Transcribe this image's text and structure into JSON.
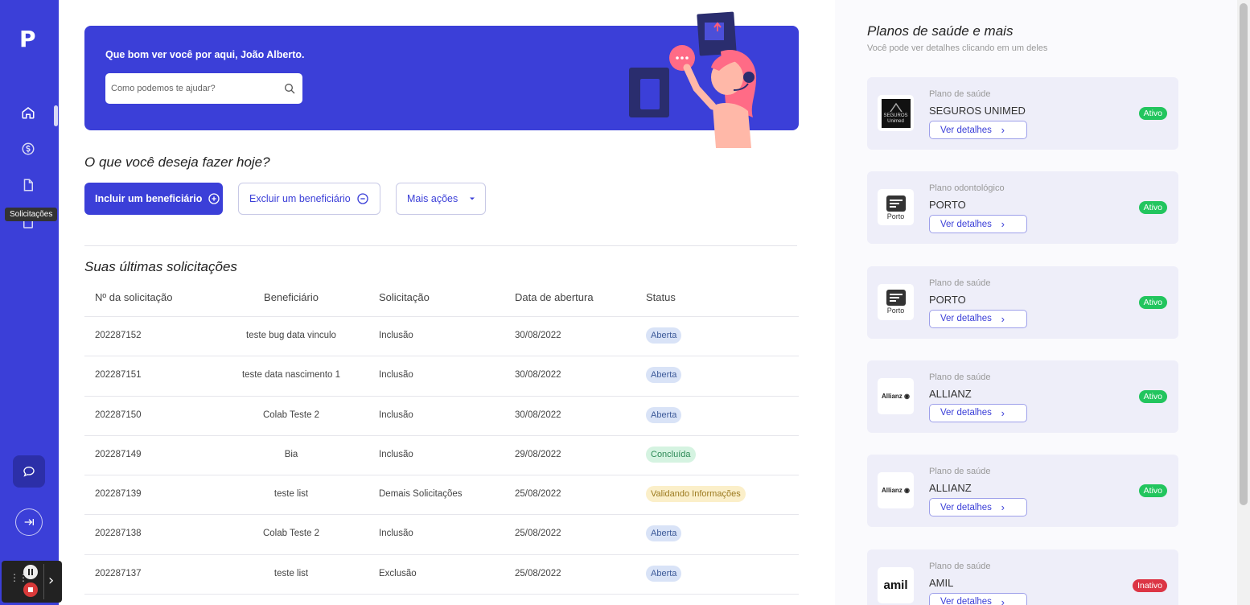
{
  "sidebar": {
    "logo": "P",
    "tooltip": "Solicitações"
  },
  "banner": {
    "greeting": "Que bom ver você por aqui, João Alberto.",
    "search_placeholder": "Como podemos te ajudar?"
  },
  "actions": {
    "title": "O que você deseja fazer hoje?",
    "include": "Incluir um beneficiário",
    "exclude": "Excluir um beneficiário",
    "more": "Mais ações"
  },
  "requests": {
    "title": "Suas últimas solicitações",
    "headers": [
      "Nº da solicitação",
      "Beneficiário",
      "Solicitação",
      "Data de abertura",
      "Status"
    ],
    "rows": [
      {
        "id": "202287152",
        "beneficiary": "teste bug data vinculo",
        "type": "Inclusão",
        "date": "30/08/2022",
        "status": "Aberta"
      },
      {
        "id": "202287151",
        "beneficiary": "teste data nascimento 1",
        "type": "Inclusão",
        "date": "30/08/2022",
        "status": "Aberta"
      },
      {
        "id": "202287150",
        "beneficiary": "Colab Teste 2",
        "type": "Inclusão",
        "date": "30/08/2022",
        "status": "Aberta"
      },
      {
        "id": "202287149",
        "beneficiary": "Bia",
        "type": "Inclusão",
        "date": "29/08/2022",
        "status": "Concluída"
      },
      {
        "id": "202287139",
        "beneficiary": "teste list",
        "type": "Demais Solicitações",
        "date": "25/08/2022",
        "status": "Validando Informações"
      },
      {
        "id": "202287138",
        "beneficiary": "Colab Teste 2",
        "type": "Inclusão",
        "date": "25/08/2022",
        "status": "Aberta"
      },
      {
        "id": "202287137",
        "beneficiary": "teste list",
        "type": "Exclusão",
        "date": "25/08/2022",
        "status": "Aberta"
      }
    ]
  },
  "status_colors": {
    "Aberta": {
      "bg": "#d9e3f7",
      "fg": "#3d5a99"
    },
    "Concluída": {
      "bg": "#d5f3e1",
      "fg": "#2e8a57"
    },
    "Validando Informações": {
      "bg": "#fbefc9",
      "fg": "#9c7a1f"
    }
  },
  "plans": {
    "title": "Planos de saúde e mais",
    "subtitle": "Você pode ver detalhes clicando em um deles",
    "details_label": "Ver detalhes",
    "items": [
      {
        "type": "Plano de saúde",
        "name": "SEGUROS UNIMED",
        "status": "Ativo",
        "logo": "SEGUROS Unimed"
      },
      {
        "type": "Plano odontológico",
        "name": "PORTO",
        "status": "Ativo",
        "logo": "Porto"
      },
      {
        "type": "Plano de saúde",
        "name": "PORTO",
        "status": "Ativo",
        "logo": "Porto"
      },
      {
        "type": "Plano de saúde",
        "name": "ALLIANZ",
        "status": "Ativo",
        "logo": "Allianz"
      },
      {
        "type": "Plano de saúde",
        "name": "ALLIANZ",
        "status": "Ativo",
        "logo": "Allianz"
      },
      {
        "type": "Plano de saúde",
        "name": "AMIL",
        "status": "Inativo",
        "logo": "amil"
      }
    ]
  },
  "colors": {
    "brand": "#3b3fd8",
    "active": "#22c55e",
    "inactive": "#dc3545"
  }
}
